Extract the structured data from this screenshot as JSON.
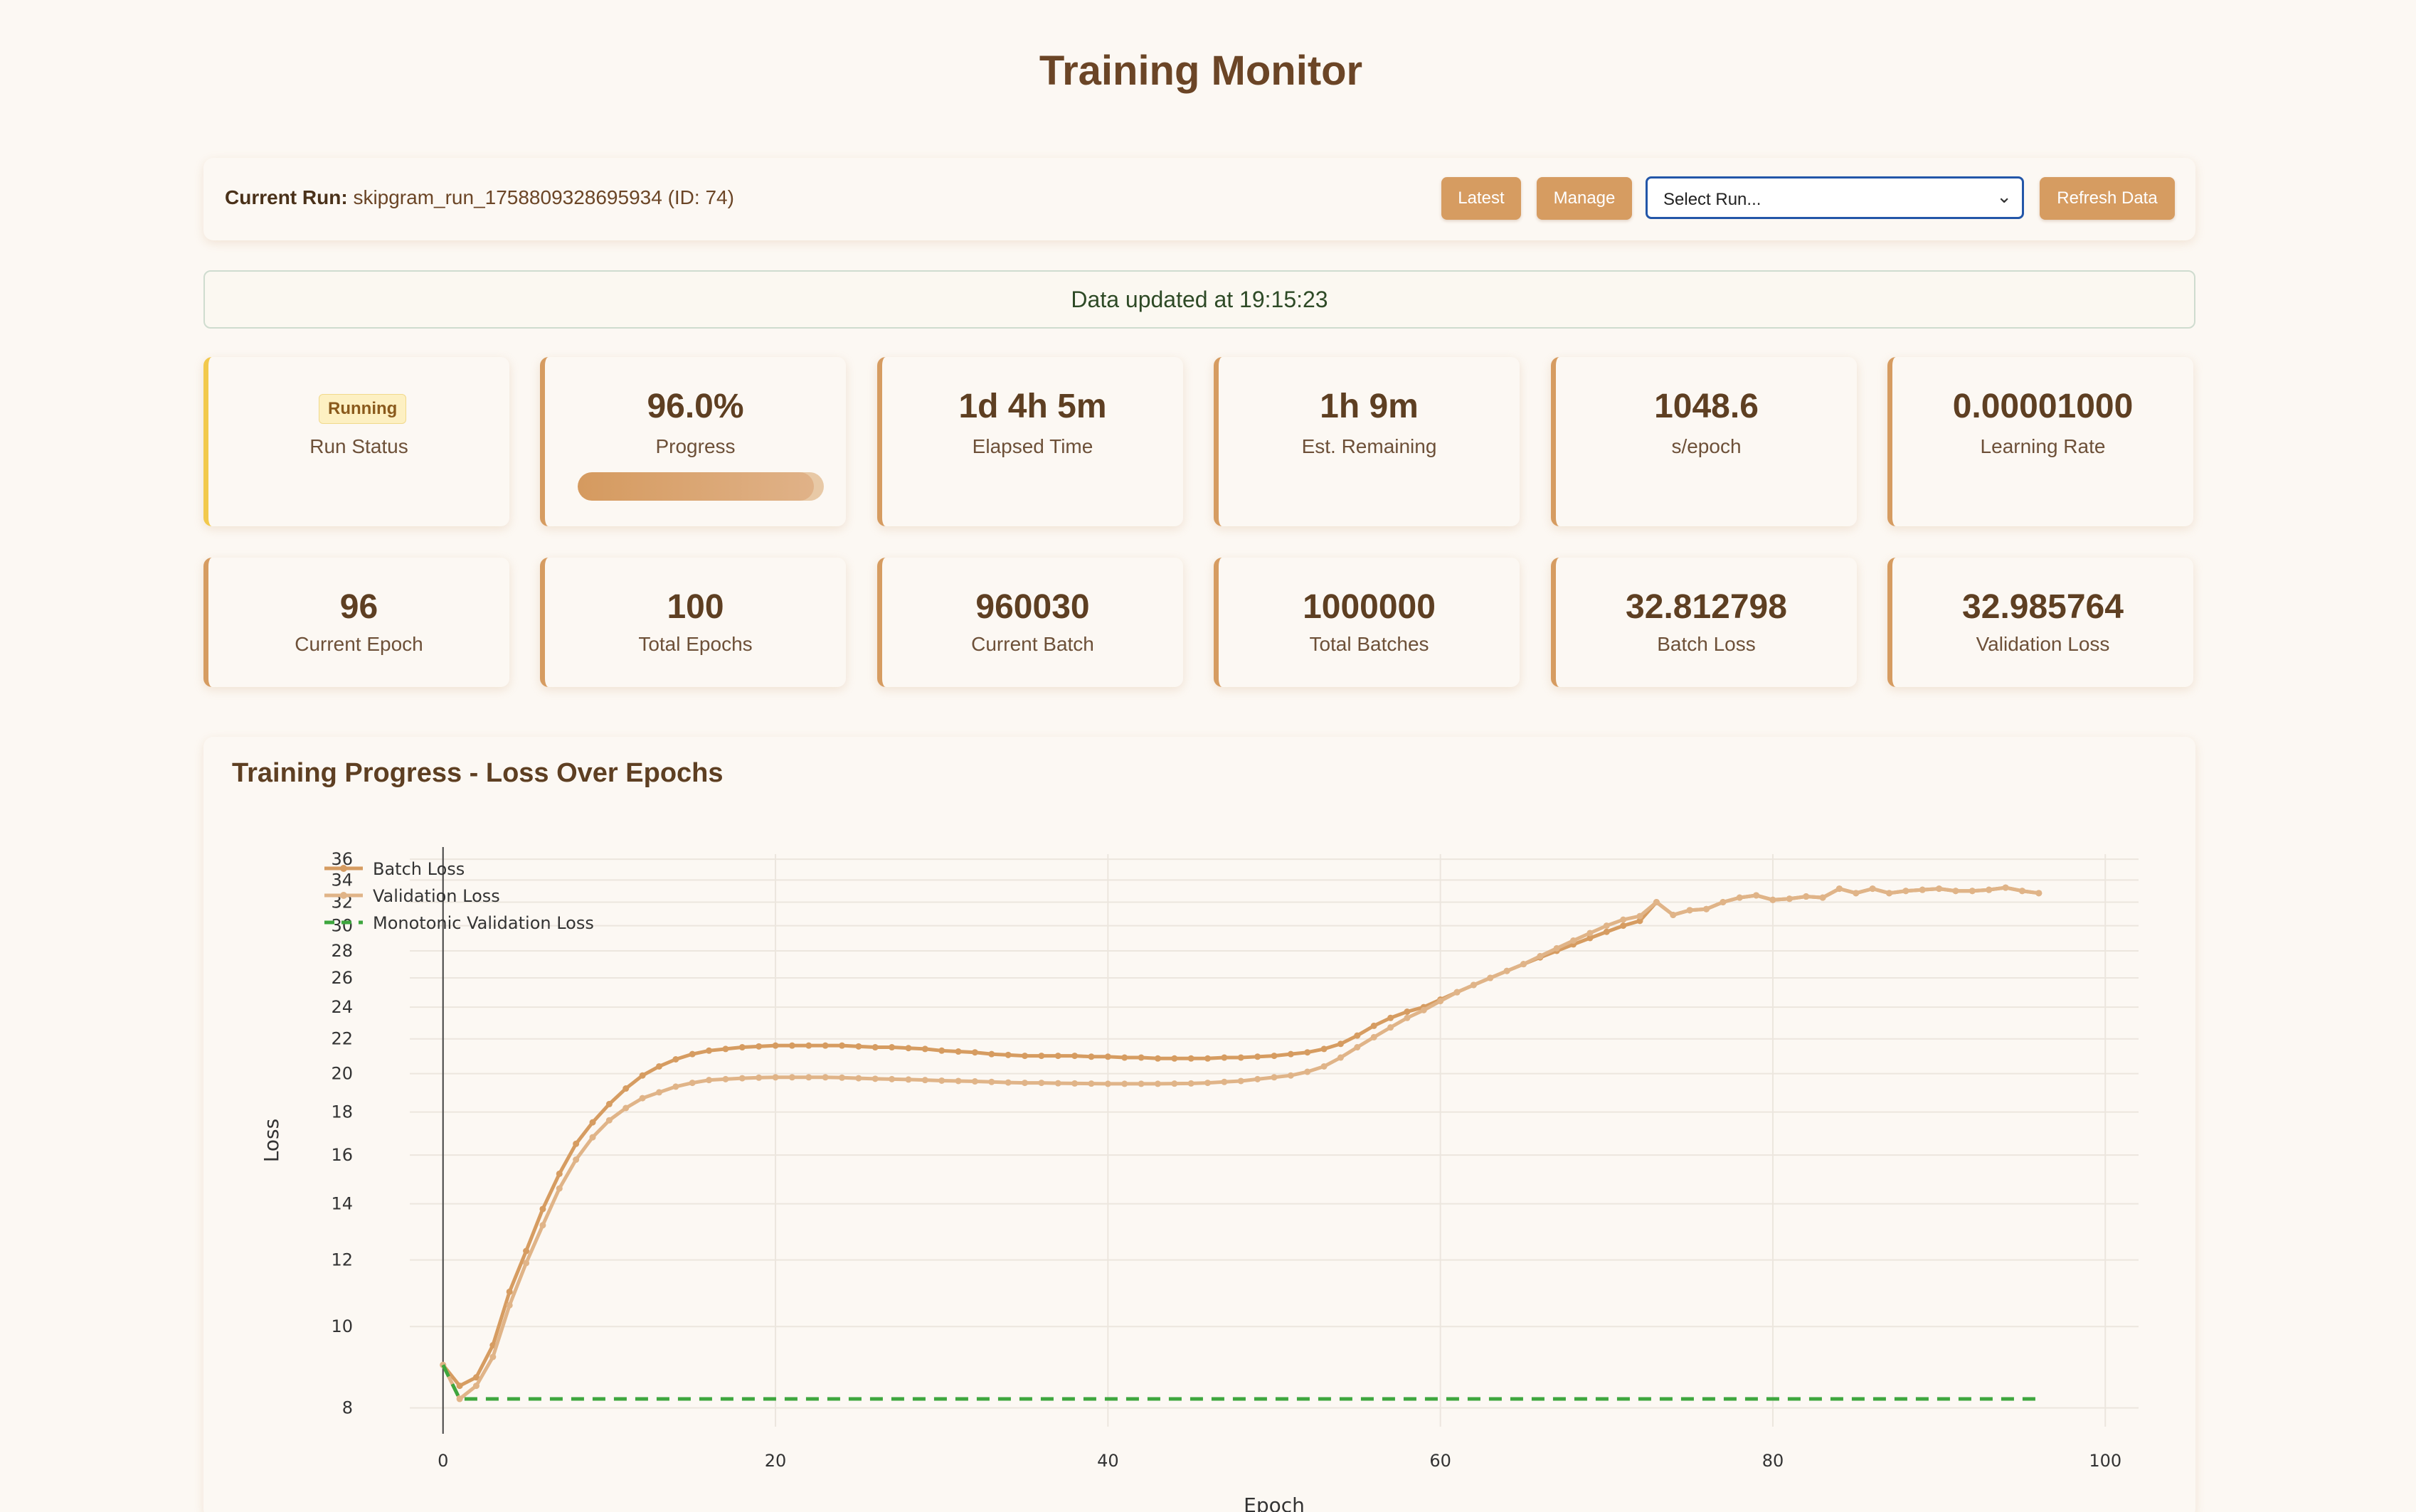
{
  "page": {
    "title": "Training Monitor"
  },
  "run_bar": {
    "label": "Current Run:",
    "value": "skipgram_run_1758809328695934 (ID: 74)",
    "latest_button": "Latest",
    "manage_button": "Manage",
    "select_placeholder": "Select Run...",
    "refresh_button": "Refresh Data"
  },
  "status_banner": "Data updated at 19:15:23",
  "metrics_row1": [
    {
      "value": "Running",
      "label": "Run Status"
    },
    {
      "value": "96.0%",
      "label": "Progress",
      "progress_fraction": 0.96
    },
    {
      "value": "1d 4h 5m",
      "label": "Elapsed Time"
    },
    {
      "value": "1h 9m",
      "label": "Est. Remaining"
    },
    {
      "value": "1048.6",
      "label": "s/epoch"
    },
    {
      "value": "0.00001000",
      "label": "Learning Rate"
    }
  ],
  "metrics_row2": [
    {
      "value": "96",
      "label": "Current Epoch"
    },
    {
      "value": "100",
      "label": "Total Epochs"
    },
    {
      "value": "960030",
      "label": "Current Batch"
    },
    {
      "value": "1000000",
      "label": "Total Batches"
    },
    {
      "value": "32.812798",
      "label": "Batch Loss"
    },
    {
      "value": "32.985764",
      "label": "Validation Loss"
    }
  ],
  "colors": {
    "accent": "#d69c61",
    "running_badge": "#fdf0c2",
    "batch_loss": "#d69c61",
    "validation_loss": "#e0b488",
    "monotonic_loss": "#3ea63e"
  },
  "chart_data": {
    "type": "line",
    "title": "Training Progress - Loss Over Epochs",
    "xlabel": "Epoch",
    "ylabel": "Loss",
    "x_scale": "linear",
    "y_scale": "log",
    "xlim": [
      -2,
      102
    ],
    "ylim": [
      7.6,
      36.5
    ],
    "x_ticks": [
      0,
      20,
      40,
      60,
      80,
      100
    ],
    "y_ticks": [
      8,
      10,
      12,
      14,
      16,
      18,
      20,
      22,
      24,
      26,
      28,
      30,
      32,
      34,
      36
    ],
    "grid": true,
    "legend_position": "top-left",
    "series": [
      {
        "name": "Batch Loss",
        "style": "line-markers",
        "x": [
          0,
          1,
          2,
          3,
          4,
          5,
          6,
          7,
          8,
          9,
          10,
          11,
          12,
          13,
          14,
          15,
          16,
          17,
          18,
          19,
          20,
          21,
          22,
          23,
          24,
          25,
          26,
          27,
          28,
          29,
          30,
          31,
          32,
          33,
          34,
          35,
          36,
          37,
          38,
          39,
          40,
          41,
          42,
          43,
          44,
          45,
          46,
          47,
          48,
          49,
          50,
          51,
          52,
          53,
          54,
          55,
          56,
          57,
          58,
          59,
          60,
          61,
          62,
          63,
          64,
          65,
          66,
          67,
          68,
          69,
          70,
          71,
          72,
          73,
          74,
          75,
          76,
          77,
          78,
          79,
          80,
          81,
          82,
          83,
          84,
          85,
          86,
          87,
          88,
          89,
          90,
          91,
          92,
          93,
          94,
          95,
          96
        ],
        "values": [
          9.0,
          8.5,
          8.7,
          9.5,
          11.0,
          12.3,
          13.8,
          15.2,
          16.5,
          17.5,
          18.4,
          19.2,
          19.9,
          20.4,
          20.8,
          21.1,
          21.3,
          21.4,
          21.5,
          21.55,
          21.6,
          21.6,
          21.6,
          21.6,
          21.6,
          21.55,
          21.5,
          21.5,
          21.45,
          21.4,
          21.3,
          21.25,
          21.2,
          21.1,
          21.05,
          21.0,
          21.0,
          21.0,
          21.0,
          20.95,
          20.95,
          20.9,
          20.9,
          20.85,
          20.85,
          20.85,
          20.85,
          20.9,
          20.9,
          20.95,
          21.0,
          21.1,
          21.2,
          21.4,
          21.7,
          22.2,
          22.8,
          23.3,
          23.7,
          24.0,
          24.5,
          25.0,
          25.5,
          26.0,
          26.5,
          27.0,
          27.5,
          28.0,
          28.5,
          29.0,
          29.5,
          30.0,
          30.4,
          32.0,
          30.9,
          31.3,
          31.4,
          32.0,
          32.4,
          32.6,
          32.2,
          32.3,
          32.5,
          32.4,
          33.2,
          32.8,
          33.2,
          32.8,
          33.0,
          33.1,
          33.2,
          33.0,
          33.0,
          33.1,
          33.3,
          33.0,
          32.8
        ]
      },
      {
        "name": "Validation Loss",
        "style": "line-markers",
        "x": [
          0,
          1,
          2,
          3,
          4,
          5,
          6,
          7,
          8,
          9,
          10,
          11,
          12,
          13,
          14,
          15,
          16,
          17,
          18,
          19,
          20,
          21,
          22,
          23,
          24,
          25,
          26,
          27,
          28,
          29,
          30,
          31,
          32,
          33,
          34,
          35,
          36,
          37,
          38,
          39,
          40,
          41,
          42,
          43,
          44,
          45,
          46,
          47,
          48,
          49,
          50,
          51,
          52,
          53,
          54,
          55,
          56,
          57,
          58,
          59,
          60,
          61,
          62,
          63,
          64,
          65,
          66,
          67,
          68,
          69,
          70,
          71,
          72,
          73,
          74,
          75,
          76,
          77,
          78,
          79,
          80,
          81,
          82,
          83,
          84,
          85,
          86,
          87,
          88,
          89,
          90,
          91,
          92,
          93,
          94,
          95,
          96
        ],
        "values": [
          9.0,
          8.2,
          8.5,
          9.2,
          10.6,
          11.9,
          13.2,
          14.6,
          15.8,
          16.8,
          17.6,
          18.2,
          18.7,
          19.0,
          19.3,
          19.5,
          19.65,
          19.7,
          19.75,
          19.78,
          19.8,
          19.8,
          19.8,
          19.8,
          19.78,
          19.75,
          19.72,
          19.7,
          19.68,
          19.65,
          19.62,
          19.6,
          19.58,
          19.55,
          19.52,
          19.5,
          19.5,
          19.48,
          19.47,
          19.46,
          19.45,
          19.45,
          19.45,
          19.45,
          19.46,
          19.47,
          19.5,
          19.55,
          19.6,
          19.7,
          19.8,
          19.9,
          20.1,
          20.4,
          20.9,
          21.5,
          22.1,
          22.7,
          23.3,
          23.8,
          24.4,
          25.0,
          25.5,
          26.0,
          26.5,
          27.0,
          27.6,
          28.2,
          28.8,
          29.4,
          30.0,
          30.5,
          30.8,
          32.0,
          30.9,
          31.3,
          31.4,
          32.0,
          32.4,
          32.6,
          32.2,
          32.3,
          32.5,
          32.4,
          33.2,
          32.8,
          33.2,
          32.8,
          33.0,
          33.1,
          33.2,
          33.0,
          33.0,
          33.1,
          33.3,
          33.0,
          32.8
        ]
      },
      {
        "name": "Monotonic Validation Loss",
        "style": "dashed",
        "x": [
          0,
          1,
          2,
          96
        ],
        "values": [
          9.0,
          8.2,
          8.2,
          8.2
        ]
      }
    ]
  }
}
